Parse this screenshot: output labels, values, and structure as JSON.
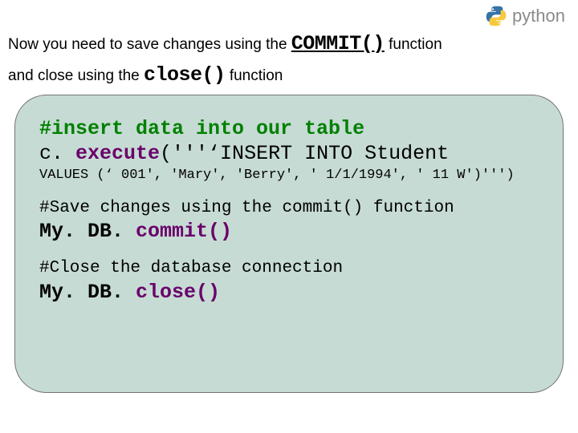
{
  "logo": {
    "word": "python"
  },
  "intro": {
    "pre1": "Now you need to save changes using the ",
    "kw_commit": "COMMIT()",
    "post1": "   function",
    "pre2": "and close using the ",
    "kw_close": "close()",
    "post2": "  function"
  },
  "code": {
    "l1": "#insert data into our table",
    "l2a": "c. ",
    "l2b": "execute",
    "l2c": "('''‘INSERT INTO Student",
    "l3": "VALUES (‘ 001', 'Mary', 'Berry', ' 1/1/1994', ' 11 W')''')",
    "l4": "#Save changes using the commit() function",
    "l5a": "My. DB. ",
    "l5b": "commit()",
    "l6": "#Close the database connection",
    "l7a": "My. DB. ",
    "l7b": "close()"
  }
}
